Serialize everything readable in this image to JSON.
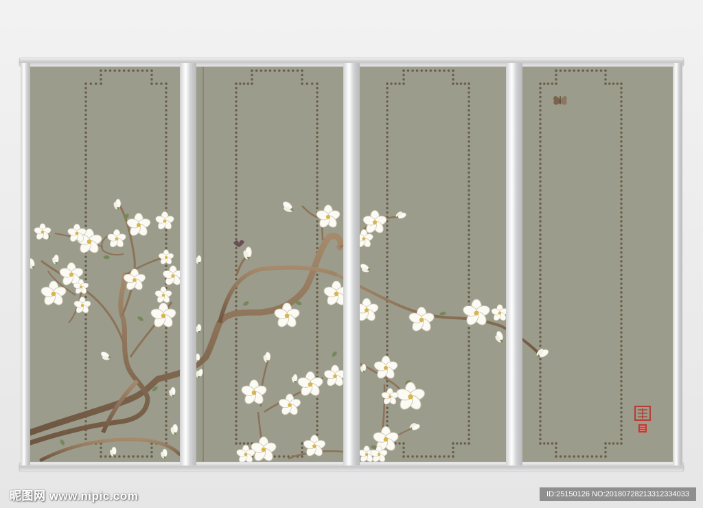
{
  "watermark": {
    "site": "昵图网 www.nipic.com",
    "id_text": "ID:25150126 NO:20180728213312334033"
  },
  "colors": {
    "panel": "#9b9c8b",
    "frame": "#c9cacb",
    "rivet": "#6a5c4a",
    "branch": "#8c7258",
    "blossom": "#faf8f1",
    "seal": "#b8332c"
  }
}
